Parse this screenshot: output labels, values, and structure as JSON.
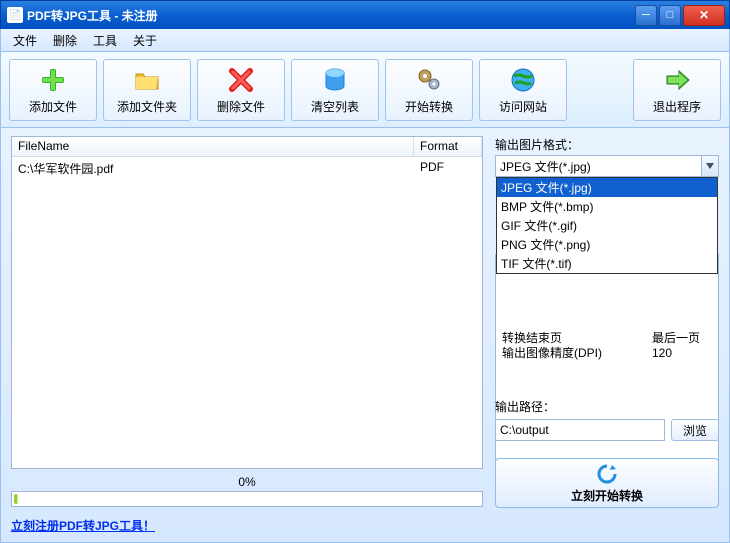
{
  "window": {
    "title": "PDF转JPG工具 - 未注册"
  },
  "menu": {
    "file": "文件",
    "delete": "删除",
    "tools": "工具",
    "about": "关于"
  },
  "toolbar": {
    "add_file": "添加文件",
    "add_folder": "添加文件夹",
    "delete_file": "删除文件",
    "clear_list": "清空列表",
    "start_convert": "开始转换",
    "visit_site": "访问网站",
    "exit": "退出程序"
  },
  "filelist": {
    "col_name": "FileName",
    "col_format": "Format",
    "rows": [
      {
        "name": "C:\\华军软件园.pdf",
        "format": "PDF"
      }
    ]
  },
  "progress": {
    "text": "0%"
  },
  "register_link": "立刻注册PDF转JPG工具！",
  "right": {
    "format_label": "输出图片格式：",
    "combo_selected": "JPEG 文件(*.jpg)",
    "options": [
      "JPEG 文件(*.jpg)",
      "BMP 文件(*.bmp)",
      "GIF 文件(*.gif)",
      "PNG 文件(*.png)",
      "TIF 文件(*.tif)"
    ],
    "selected_index": 0,
    "settings": [
      {
        "k": "转换结束页",
        "v": "最后一页"
      },
      {
        "k": "输出图像精度(DPI)",
        "v": "120"
      }
    ],
    "output_label": "输出路径：",
    "output_path": "C:\\output",
    "browse": "浏览",
    "start_now": "立刻开始转换"
  }
}
